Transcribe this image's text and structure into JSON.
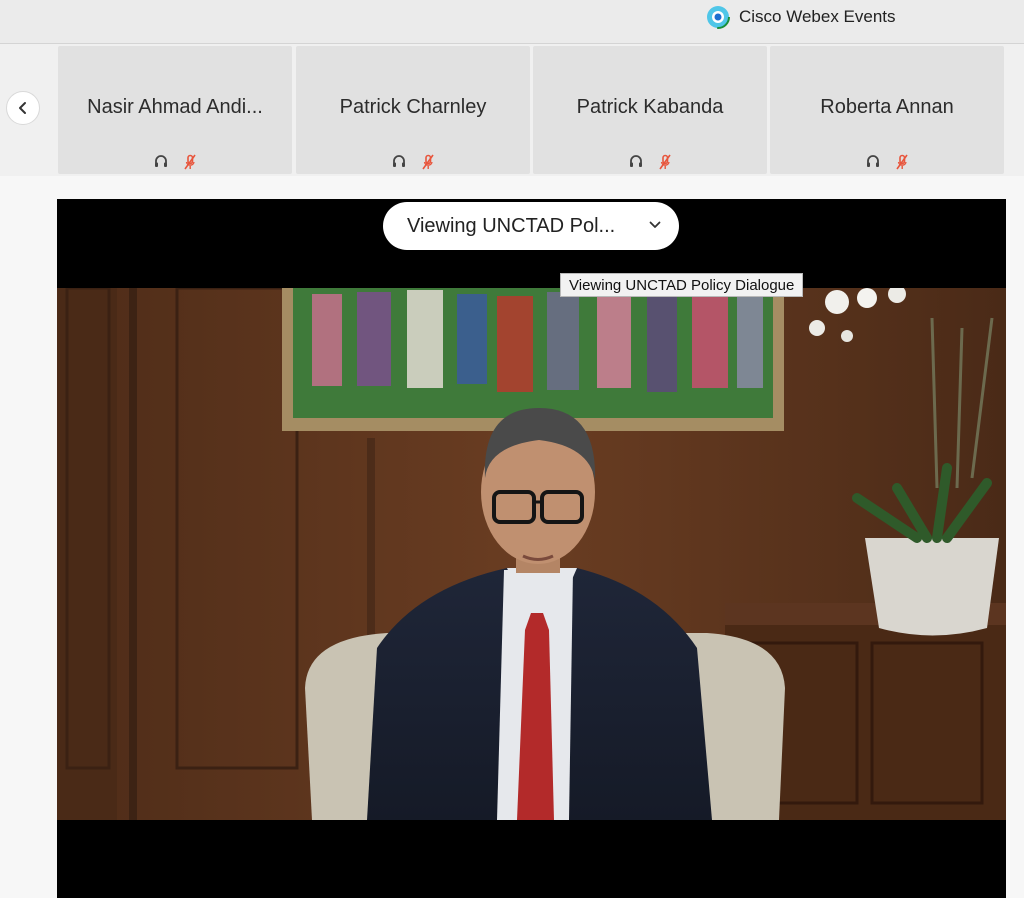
{
  "app": {
    "title": "Cisco Webex Events",
    "logo_icon": "webex-logo-icon"
  },
  "participants": [
    {
      "name": "Nasir Ahmad Andi...",
      "audio_icon": "headset-icon",
      "mic_icon": "mic-muted-icon"
    },
    {
      "name": "Patrick Charnley",
      "audio_icon": "headset-icon",
      "mic_icon": "mic-muted-icon"
    },
    {
      "name": "Patrick Kabanda",
      "audio_icon": "headset-icon",
      "mic_icon": "mic-muted-icon"
    },
    {
      "name": "Roberta Annan",
      "audio_icon": "headset-icon",
      "mic_icon": "mic-muted-icon"
    }
  ],
  "video": {
    "view_selector_label": "Viewing UNCTAD Pol...",
    "view_selector_tooltip": "Viewing UNCTAD Policy Dialogue"
  },
  "colors": {
    "muted_red": "#e8553c",
    "video_bg": "#000000",
    "tile_bg": "#e1e1e1"
  }
}
